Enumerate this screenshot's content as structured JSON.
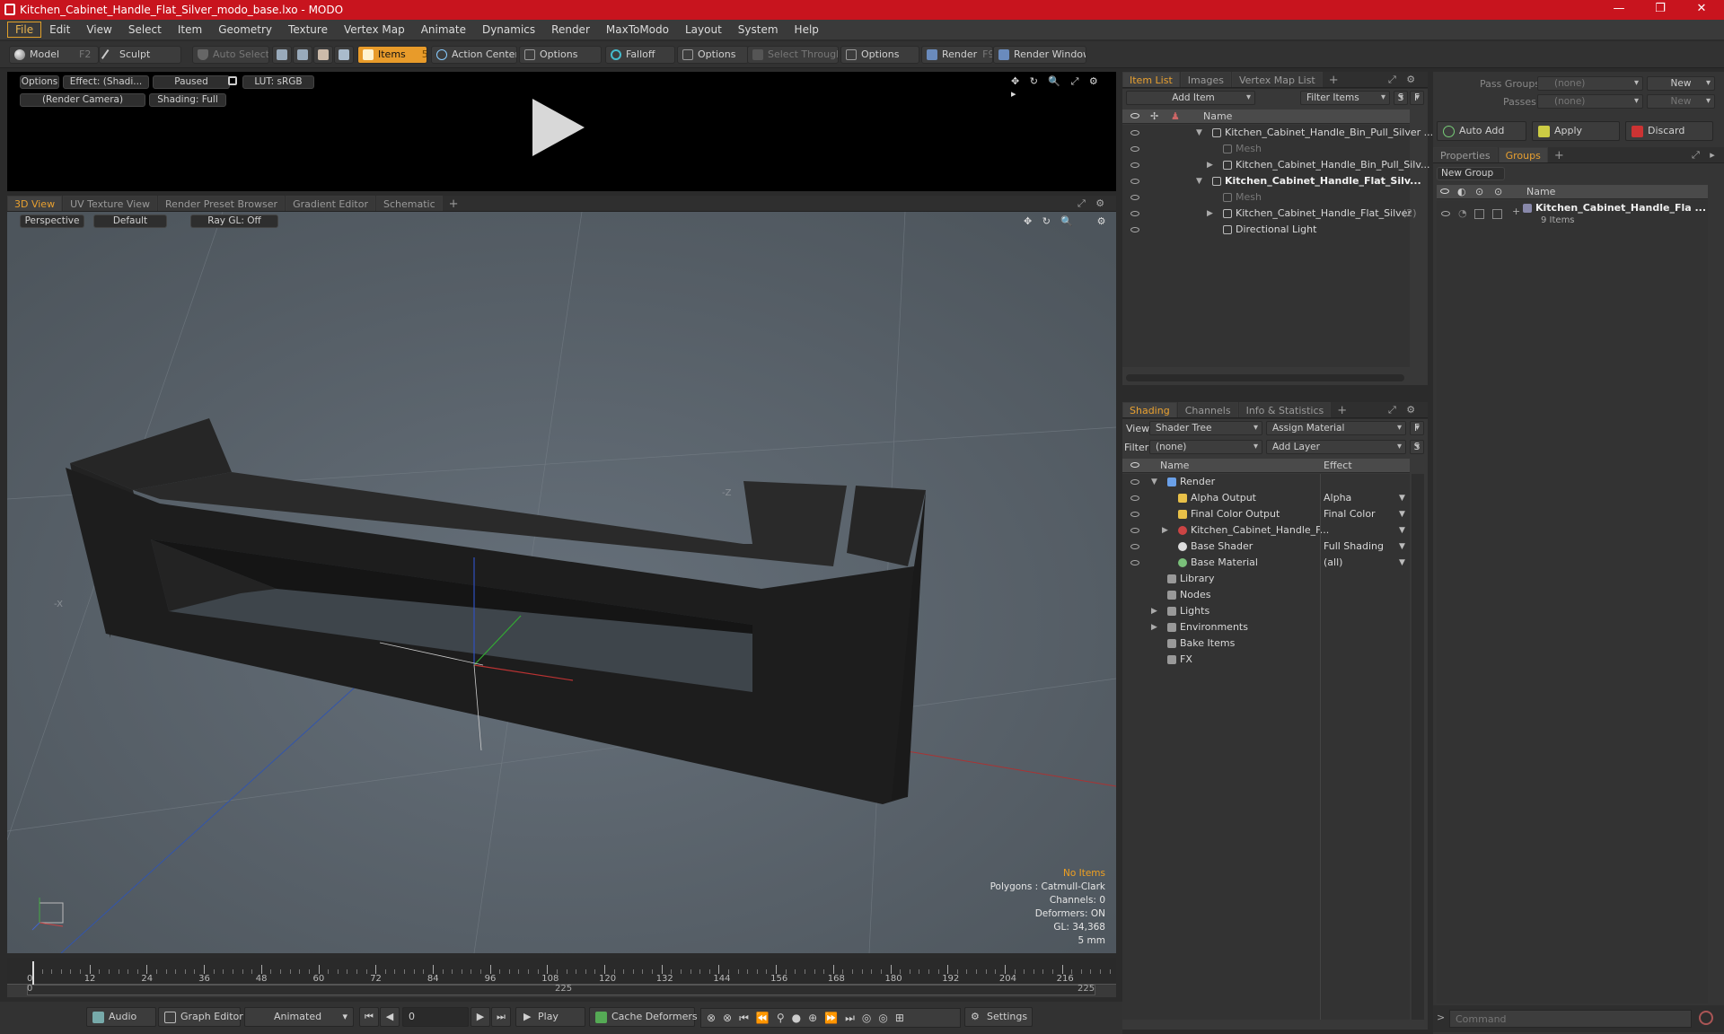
{
  "window": {
    "title": "Kitchen_Cabinet_Handle_Flat_Silver_modo_base.lxo - MODO",
    "min": "—",
    "max": "❐",
    "close": "✕"
  },
  "menu": [
    "File",
    "Edit",
    "View",
    "Select",
    "Item",
    "Geometry",
    "Texture",
    "Vertex Map",
    "Animate",
    "Dynamics",
    "Render",
    "MaxToModo",
    "Layout",
    "System",
    "Help"
  ],
  "toolbar": {
    "model": "Model",
    "model_key": "F2",
    "sculpt": "Sculpt",
    "auto_select": "Auto Select",
    "items": "Items",
    "items_key": "5",
    "action_center": "Action Center",
    "options1": "Options",
    "falloff": "Falloff",
    "options2": "Options",
    "select_through": "Select Through",
    "options3": "Options",
    "render": "Render",
    "render_key": "F9",
    "render_window": "Render Window"
  },
  "preview": {
    "options": "Options",
    "effect": "Effect: (Shadi...",
    "paused": "Paused",
    "lut": "LUT: sRGB",
    "camera": "(Render Camera)",
    "shading": "Shading: Full"
  },
  "viewport_tabs": [
    "3D View",
    "UV Texture View",
    "Render Preset Browser",
    "Gradient Editor",
    "Schematic"
  ],
  "viewport": {
    "perspective": "Perspective",
    "default": "Default",
    "raygl": "Ray GL: Off",
    "axis_z": "-Z",
    "axis_x": "-X",
    "stats": {
      "no_items": "No Items",
      "polygons": "Polygons : Catmull-Clark",
      "channels": "Channels: 0",
      "deformers": "Deformers: ON",
      "gl": "GL: 34,368",
      "unit": "5 mm"
    }
  },
  "timeline": {
    "ticks": [
      "0",
      "12",
      "24",
      "36",
      "48",
      "60",
      "72",
      "84",
      "96",
      "108",
      "120",
      "132",
      "144",
      "156",
      "168",
      "180",
      "192",
      "204",
      "216"
    ],
    "sub_start": "0",
    "sub_mid": "225",
    "sub_end": "225"
  },
  "bottom": {
    "audio": "Audio",
    "graph": "Graph Editor",
    "animated": "Animated",
    "frame": "0",
    "play": "Play",
    "cache": "Cache Deformers",
    "settings": "Settings"
  },
  "itemlist": {
    "tabs": [
      "Item List",
      "Images",
      "Vertex Map List"
    ],
    "add_item": "Add Item",
    "filter": "Filter Items",
    "s": "S",
    "f": "F",
    "col_name": "Name",
    "rows": [
      {
        "label": "Kitchen_Cabinet_Handle_Bin_Pull_Silver ...",
        "indent": 0,
        "expand": "▼",
        "dim": false,
        "bold": false
      },
      {
        "label": "Mesh",
        "indent": 1,
        "expand": "",
        "dim": true,
        "bold": false
      },
      {
        "label": "Kitchen_Cabinet_Handle_Bin_Pull_Silv...",
        "indent": 1,
        "expand": "▶",
        "dim": false,
        "bold": false
      },
      {
        "label": "Kitchen_Cabinet_Handle_Flat_Silv...",
        "indent": 0,
        "expand": "▼",
        "dim": false,
        "bold": true
      },
      {
        "label": "Mesh",
        "indent": 1,
        "expand": "",
        "dim": true,
        "bold": false
      },
      {
        "label": "Kitchen_Cabinet_Handle_Flat_Silver",
        "suffix": "(2)",
        "indent": 1,
        "expand": "▶",
        "dim": false,
        "bold": false
      },
      {
        "label": "Directional Light",
        "indent": 1,
        "expand": "",
        "dim": false,
        "bold": false
      }
    ]
  },
  "shading": {
    "tabs": [
      "Shading",
      "Channels",
      "Info & Statistics"
    ],
    "view_label": "View",
    "view_value": "Shader Tree",
    "assign": "Assign Material",
    "f": "F",
    "filter_label": "Filter",
    "filter_value": "(none)",
    "add_layer": "Add Layer",
    "s": "S",
    "col_name": "Name",
    "col_effect": "Effect",
    "rows": [
      {
        "label": "Render",
        "effect": "",
        "indent": 0,
        "expand": "▼"
      },
      {
        "label": "Alpha Output",
        "effect": "Alpha",
        "indent": 1,
        "expand": ""
      },
      {
        "label": "Final Color Output",
        "effect": "Final Color",
        "indent": 1,
        "expand": ""
      },
      {
        "label": "Kitchen_Cabinet_Handle_F...",
        "effect": "",
        "indent": 1,
        "expand": "▶"
      },
      {
        "label": "Base Shader",
        "effect": "Full Shading",
        "indent": 1,
        "expand": ""
      },
      {
        "label": "Base Material",
        "effect": "(all)",
        "indent": 1,
        "expand": ""
      },
      {
        "label": "Library",
        "effect": "",
        "indent": 0,
        "expand": ""
      },
      {
        "label": "Nodes",
        "effect": "",
        "indent": 0,
        "expand": ""
      },
      {
        "label": "Lights",
        "effect": "",
        "indent": 0,
        "expand": "▶"
      },
      {
        "label": "Environments",
        "effect": "",
        "indent": 0,
        "expand": "▶"
      },
      {
        "label": "Bake Items",
        "effect": "",
        "indent": 0,
        "expand": ""
      },
      {
        "label": "FX",
        "effect": "",
        "indent": 0,
        "expand": ""
      }
    ]
  },
  "groups": {
    "pass_groups": "Pass Groups",
    "passes": "Passes",
    "none": "(none)",
    "new": "New",
    "auto_add": "Auto Add",
    "apply": "Apply",
    "discard": "Discard",
    "tabs": [
      "Properties",
      "Groups"
    ],
    "new_group": "New Group",
    "col_name": "Name",
    "group_name": "Kitchen_Cabinet_Handle_Fla ...",
    "group_count": "9 Items"
  },
  "command": {
    "placeholder": "Command"
  }
}
